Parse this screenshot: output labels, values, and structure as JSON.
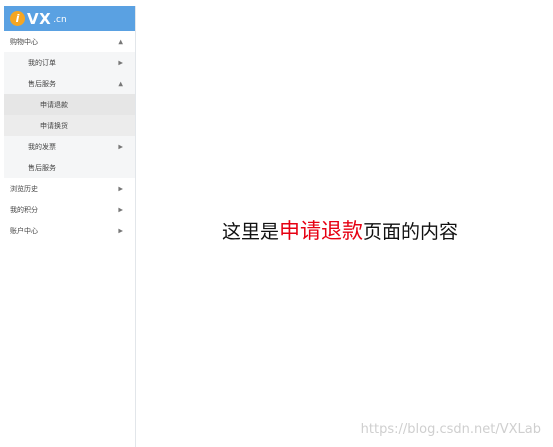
{
  "logo": {
    "badge": "i",
    "main": "VX",
    "sub": ".cn"
  },
  "menu": [
    {
      "label": "购物中心",
      "level": 1,
      "arrow": "▲",
      "active": false
    },
    {
      "label": "我的订单",
      "level": 2,
      "arrow": "▶",
      "active": false
    },
    {
      "label": "售后服务",
      "level": 2,
      "arrow": "▲",
      "active": false
    },
    {
      "label": "申请退款",
      "level": 3,
      "arrow": "",
      "active": true
    },
    {
      "label": "申请换货",
      "level": 3,
      "arrow": "",
      "active": false
    },
    {
      "label": "我的发票",
      "level": 2,
      "arrow": "▶",
      "active": false
    },
    {
      "label": "售后服务",
      "level": 2,
      "arrow": "",
      "active": false
    },
    {
      "label": "浏览历史",
      "level": 1,
      "arrow": "▶",
      "active": false
    },
    {
      "label": "我的积分",
      "level": 1,
      "arrow": "▶",
      "active": false
    },
    {
      "label": "账户中心",
      "level": 1,
      "arrow": "▶",
      "active": false
    }
  ],
  "content": {
    "prefix": "这里是",
    "highlight": "申请退款",
    "suffix": "页面的内容"
  },
  "watermark": "https://blog.csdn.net/VXLab",
  "colors": {
    "header": "#5aa1e2",
    "highlight": "#e60012",
    "badge": "#f5a623"
  }
}
